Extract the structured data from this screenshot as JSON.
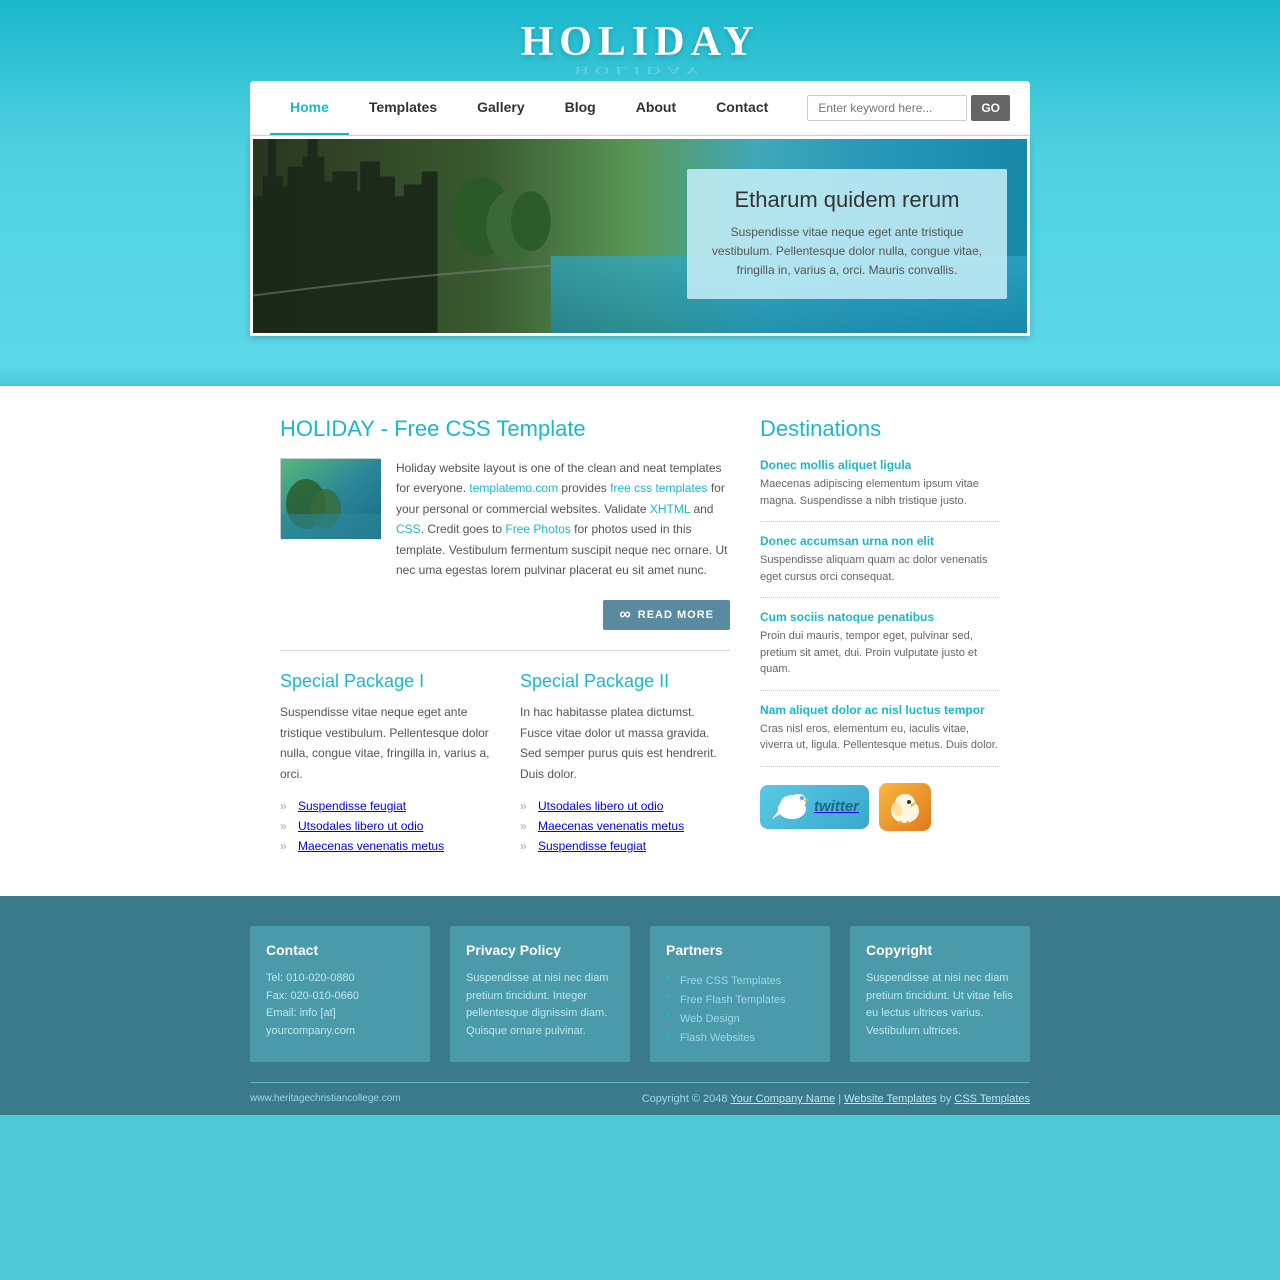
{
  "site": {
    "title": "HOLIDAY",
    "url": "www.heritagechristiancollege.com"
  },
  "nav": {
    "links": [
      {
        "label": "Home",
        "active": true
      },
      {
        "label": "Templates",
        "active": false
      },
      {
        "label": "Gallery",
        "active": false
      },
      {
        "label": "Blog",
        "active": false
      },
      {
        "label": "About",
        "active": false
      },
      {
        "label": "Contact",
        "active": false
      }
    ],
    "search_placeholder": "Enter keyword here...",
    "search_btn": "GO"
  },
  "hero": {
    "title": "Etharum quidem rerum",
    "text": "Suspendisse vitae neque eget ante tristique vestibulum. Pellentesque dolor nulla, congue vitae, fringilla in, varius a, orci. Mauris convallis."
  },
  "main": {
    "title": "HOLIDAY - Free CSS Template",
    "intro": "Holiday website layout is one of the clean and neat templates for everyone. templatemo.com provides free css templates for your personal or commercial websites. Validate XHTML and CSS. Credit goes to Free Photos for photos used in this template. Vestibulum fermentum suscipit neque nec ornare. Ut nec uma egestas lorem pulvinar placerat eu sit amet nunc.",
    "read_more": "READ MORE"
  },
  "packages": [
    {
      "title": "Special Package I",
      "text": "Suspendisse vitae neque eget ante tristique vestibulum. Pellentesque dolor nulla, congue vitae, fringilla in, varius a, orci.",
      "items": [
        "Suspendisse feugiat",
        "Utsodales libero ut odio",
        "Maecenas venenatis metus"
      ]
    },
    {
      "title": "Special Package II",
      "text": "In hac habitasse platea dictumst. Fusce vitae dolor ut massa gravida. Sed semper purus quis est hendrerit. Duis dolor.",
      "items": [
        "Utsodales libero ut odio",
        "Maecenas venenatis metus",
        "Suspendisse feugiat"
      ]
    }
  ],
  "destinations": {
    "title": "Destinations",
    "items": [
      {
        "title": "Donec mollis aliquet ligula",
        "text": "Maecenas adipiscing elementum ipsum vitae magna. Suspendisse a nibh tristique justo."
      },
      {
        "title": "Donec accumsan urna non elit",
        "text": "Suspendisse aliquam quam ac dolor venenatis eget cursus orci consequat."
      },
      {
        "title": "Cum sociis natoque penatibus",
        "text": "Proin dui mauris, tempor eget, pulvinar sed, pretium sit amet, dui. Proin vulputate justo et quam."
      },
      {
        "title": "Nam aliquet dolor ac nisl luctus tempor",
        "text": "Cras nisl eros, elementum eu, iaculis vitae, viverra ut, ligula. Pellentesque metus. Duis dolor."
      }
    ]
  },
  "footer": {
    "cols": [
      {
        "title": "Contact",
        "content": "Tel: 010-020-0880\nFax: 020-010-0660\nEmail: info [at] yourcompany.com"
      },
      {
        "title": "Privacy Policy",
        "content": "Suspendisse at nisi nec diam pretium tincidunt. Integer pellentesque dignissim diam. Quisque ornare pulvinar."
      },
      {
        "title": "Partners",
        "links": [
          "Free CSS Templates",
          "Free Flash Templates",
          "Web Design",
          "Flash Websites"
        ]
      },
      {
        "title": "Copyright",
        "content": "Suspendisse at nisi nec diam pretium tincidunt. Ut vitae felis eu lectus ultrices varius. Vestibulum ultrices."
      }
    ],
    "bottom": {
      "site_url": "www.heritagechristiancollege.com",
      "copyright": "Copyright © 2048",
      "company": "Your Company Name",
      "separator1": "|",
      "website_templates": "Website Templates",
      "separator2": "by",
      "css_templates": "CSS Templates"
    }
  }
}
